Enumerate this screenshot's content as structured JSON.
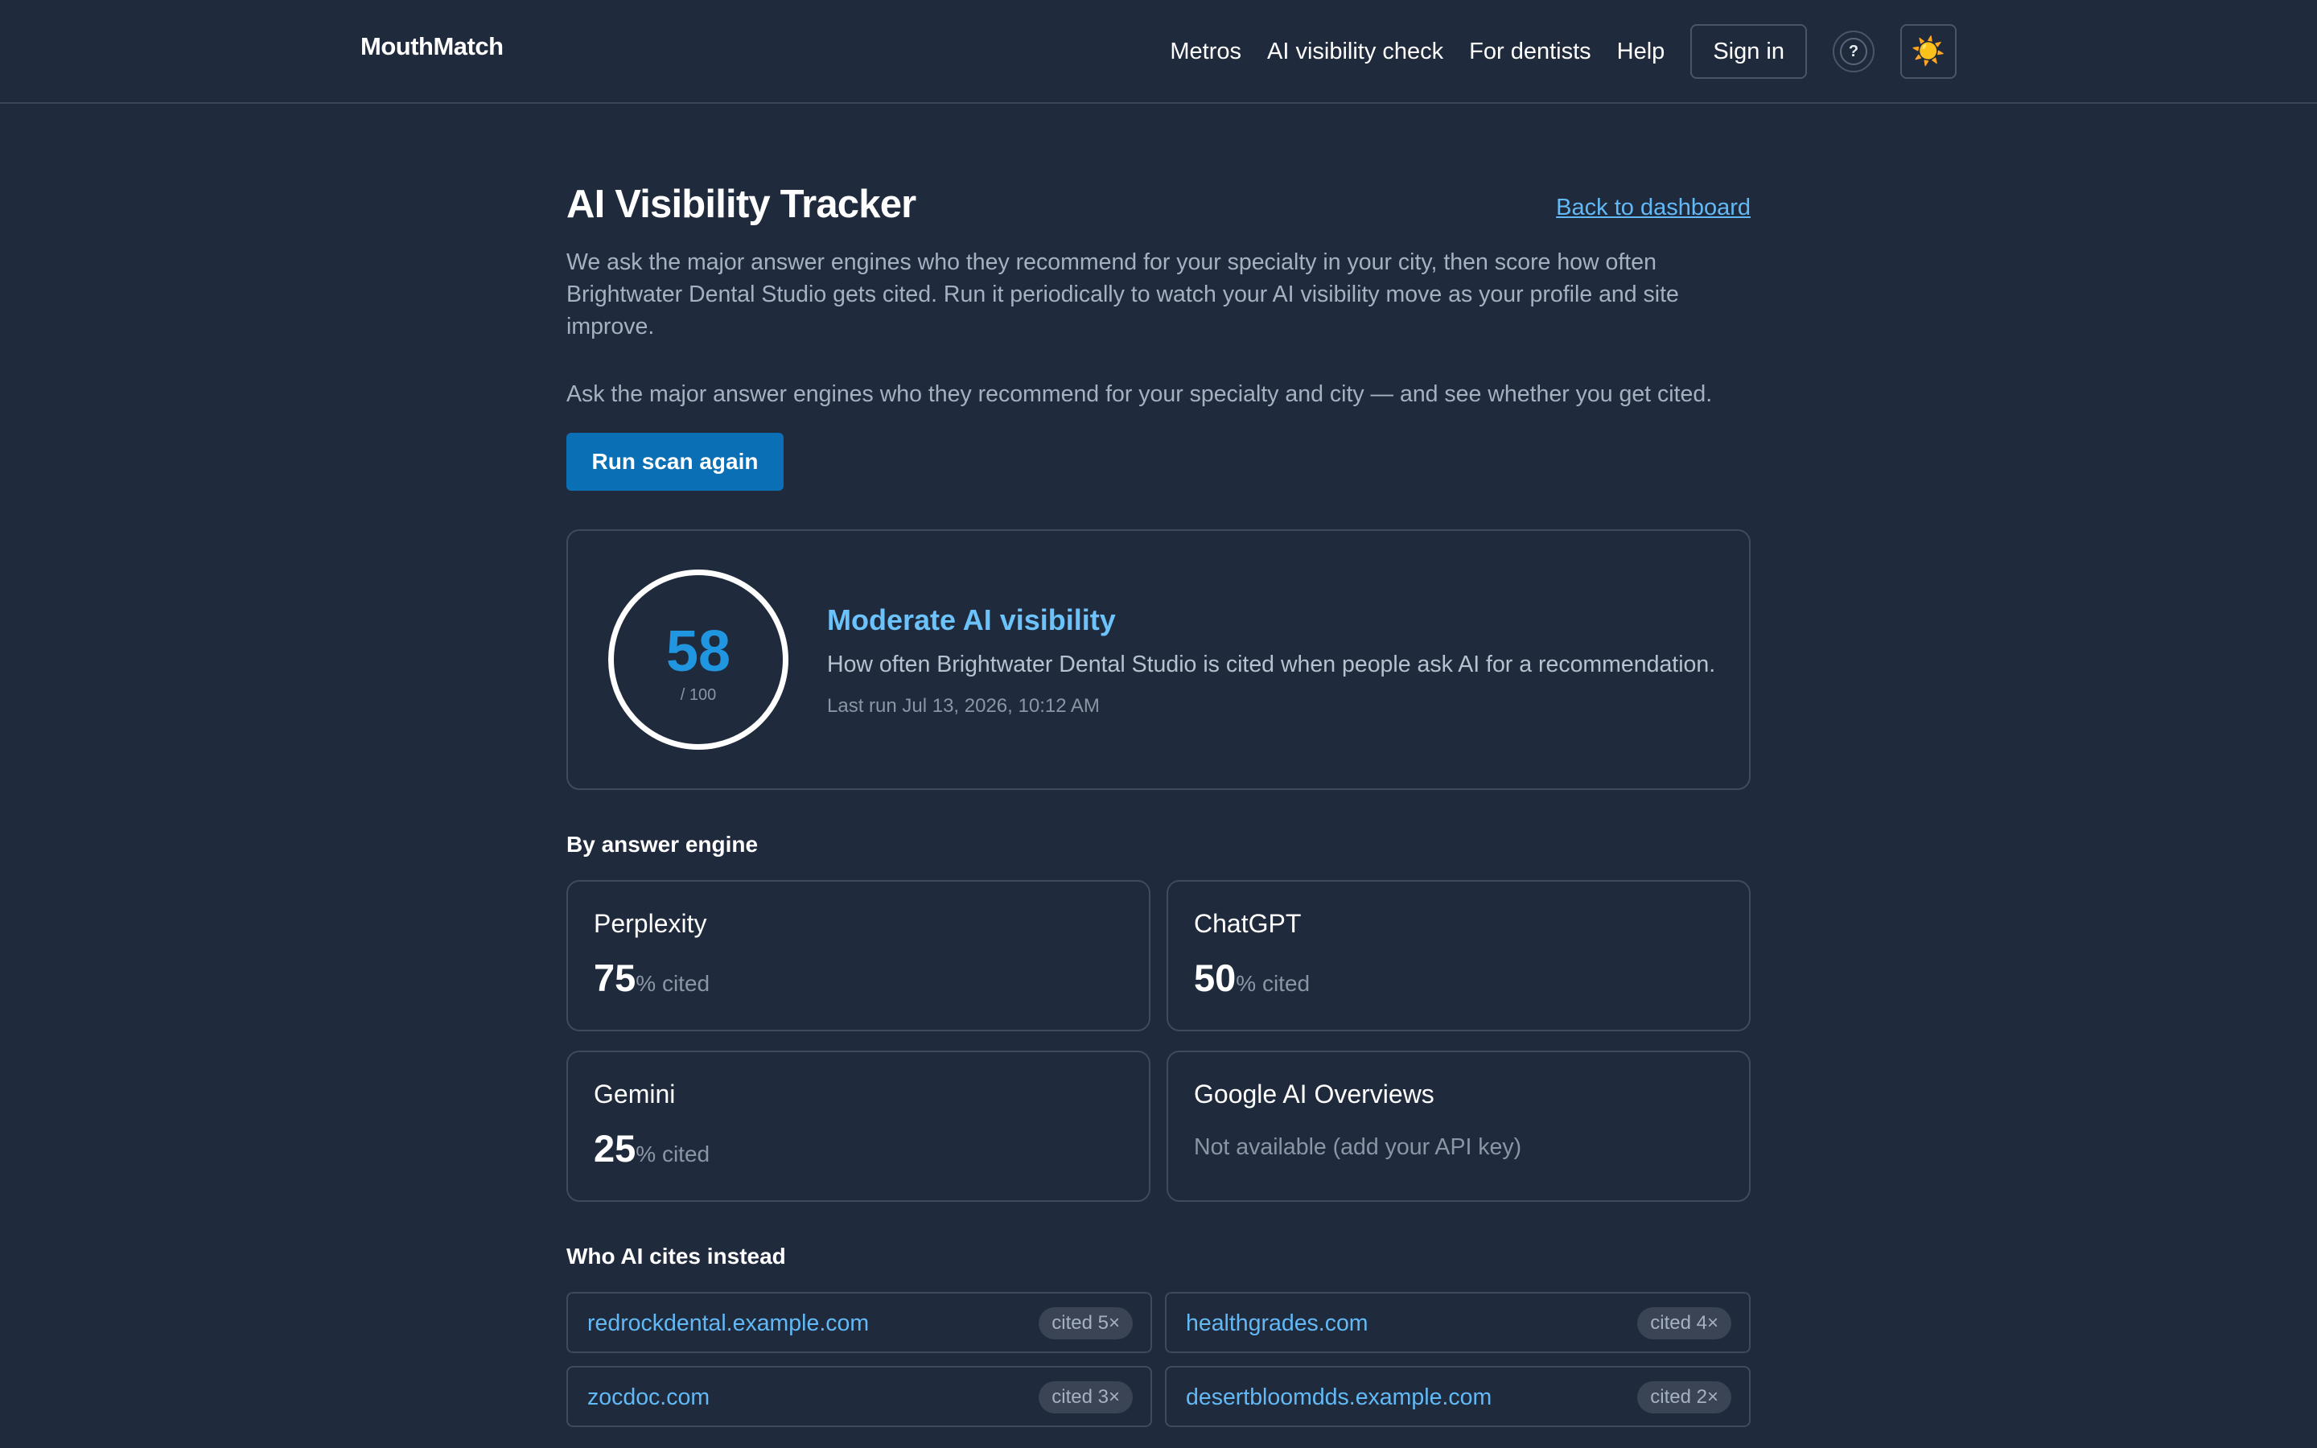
{
  "header": {
    "brand": "MouthMatch",
    "nav": [
      "Metros",
      "AI visibility check",
      "For dentists",
      "Help"
    ],
    "sign_in": "Sign in",
    "help_glyph": "?",
    "theme_icon": "☀️"
  },
  "page": {
    "title": "AI Visibility Tracker",
    "back_link": "Back to dashboard",
    "description": "We ask the major answer engines who they recommend for your specialty in your city, then score how often Brightwater Dental Studio gets cited. Run it periodically to watch your AI visibility move as your profile and site improve.",
    "subdescription": "Ask the major answer engines who they recommend for your specialty and city — and see whether you get cited.",
    "run_button": "Run scan again"
  },
  "score": {
    "value": 58,
    "max_label": "/ 100",
    "heading": "Moderate AI visibility",
    "description": "How often Brightwater Dental Studio is cited when people ask AI for a recommendation.",
    "last_run": "Last run Jul 13, 2026, 10:12 AM",
    "colors": {
      "ring": "#ffffff",
      "number": "#2196e0",
      "heading": "#6cc3fb"
    }
  },
  "engines": {
    "heading": "By answer engine",
    "unit": "% cited",
    "items": [
      {
        "name": "Perplexity",
        "value": "75"
      },
      {
        "name": "ChatGPT",
        "value": "50"
      },
      {
        "name": "Gemini",
        "value": "25"
      },
      {
        "name": "Google AI Overviews",
        "note": "Not available (add your API key)"
      }
    ]
  },
  "citations": {
    "heading": "Who AI cites instead",
    "items": [
      {
        "domain": "redrockdental.example.com",
        "badge": "cited 5×"
      },
      {
        "domain": "healthgrades.com",
        "badge": "cited 4×"
      },
      {
        "domain": "zocdoc.com",
        "badge": "cited 3×"
      },
      {
        "domain": "desertbloomdds.example.com",
        "badge": "cited 2×"
      }
    ]
  }
}
